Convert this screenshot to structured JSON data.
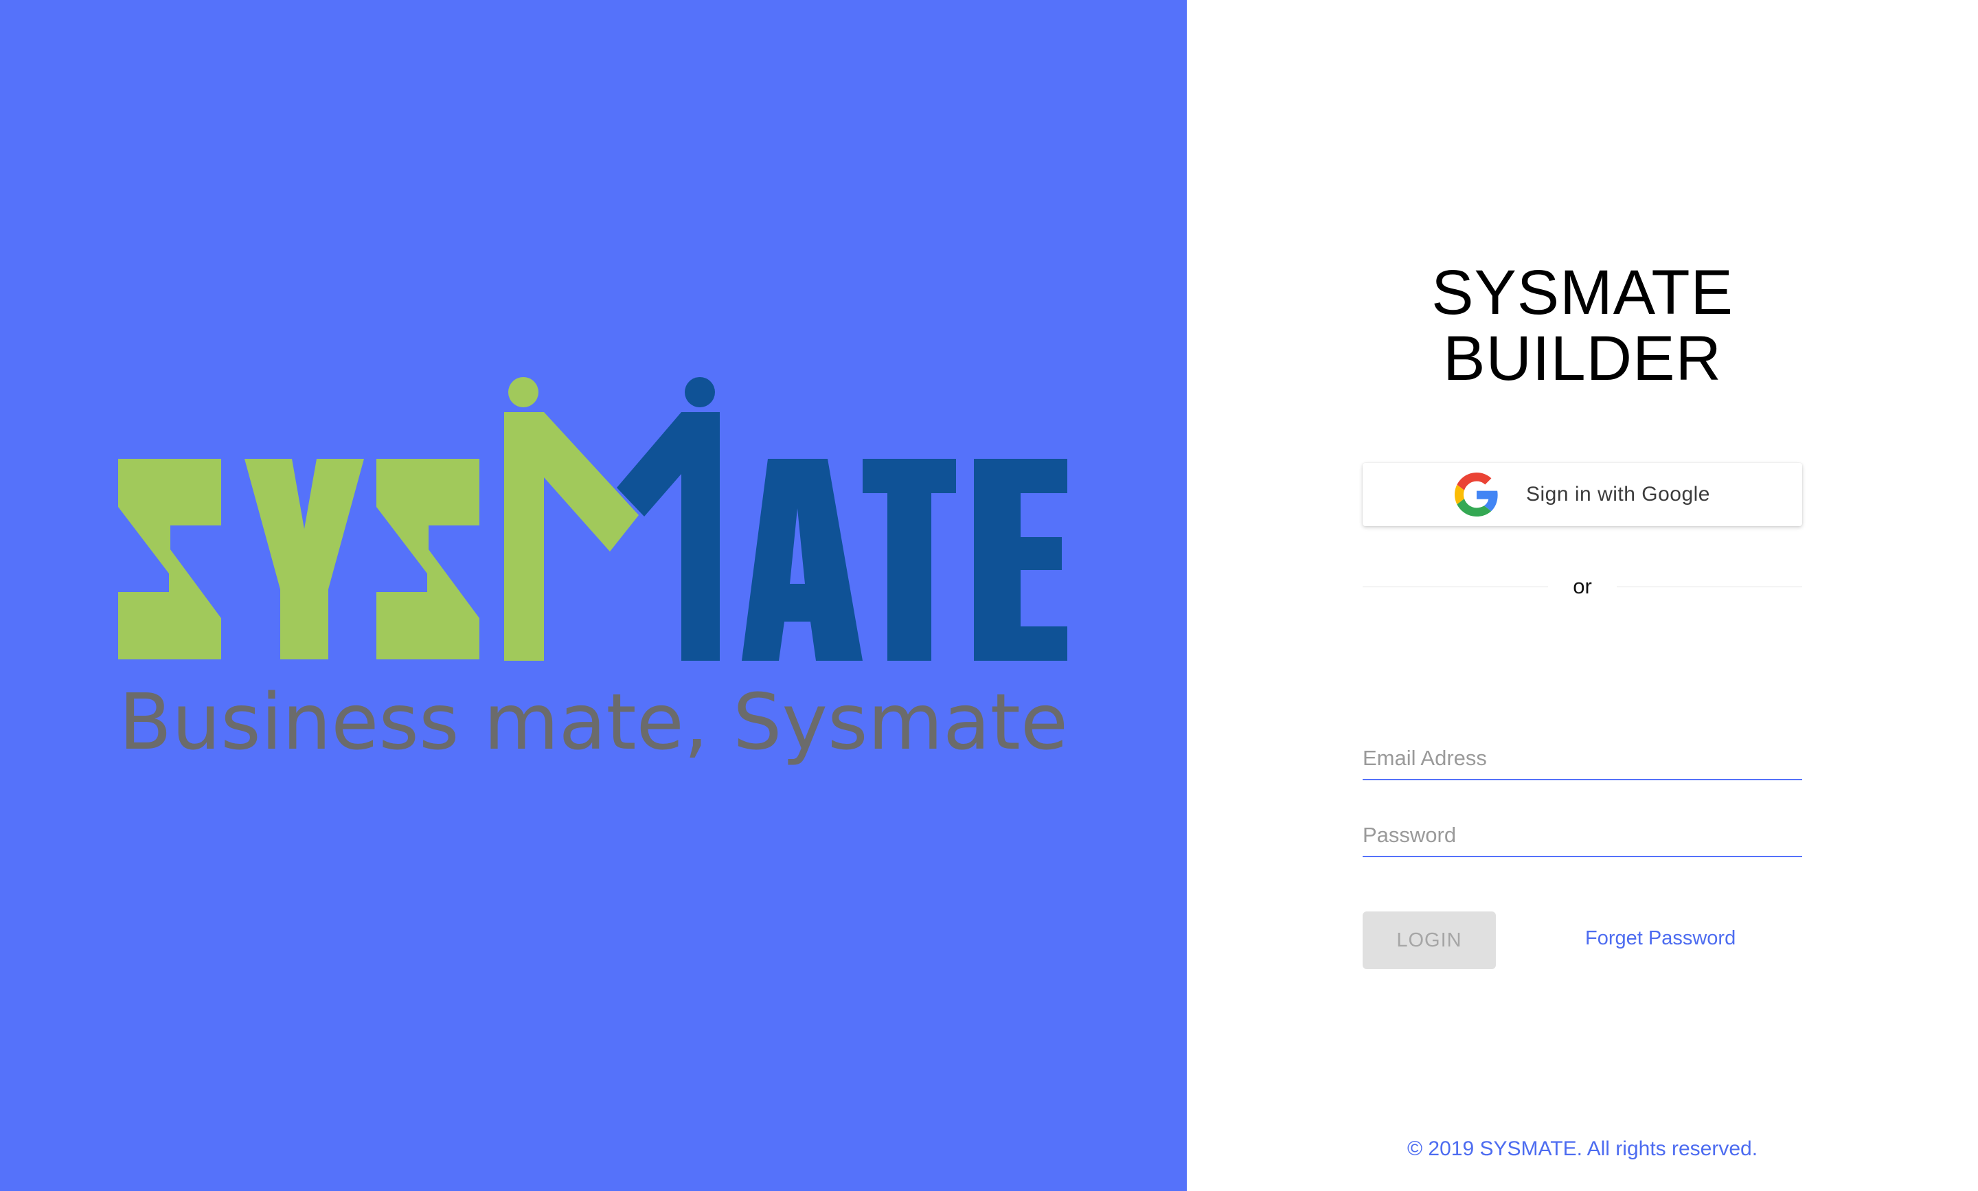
{
  "colors": {
    "left_background": "#5572fa",
    "logo_green": "#a1c95b",
    "logo_navy": "#0f5296",
    "tagline_gray": "#6b6b6b",
    "accent": "#4d6cf0"
  },
  "logo": {
    "word_part1": "SYS",
    "word_part2": "MATE",
    "tagline": "Business mate, Sysmate"
  },
  "login": {
    "title_line1": "SYSMATE",
    "title_line2": "BUILDER",
    "google_button_label": "Sign in with Google",
    "google_icon": "google-g-icon",
    "divider_text": "or",
    "email_placeholder": "Email Adress",
    "password_placeholder": "Password",
    "login_button_label": "LOGIN",
    "forget_password_label": "Forget Password"
  },
  "footer": {
    "copyright": "© 2019 SYSMATE. All rights reserved."
  }
}
